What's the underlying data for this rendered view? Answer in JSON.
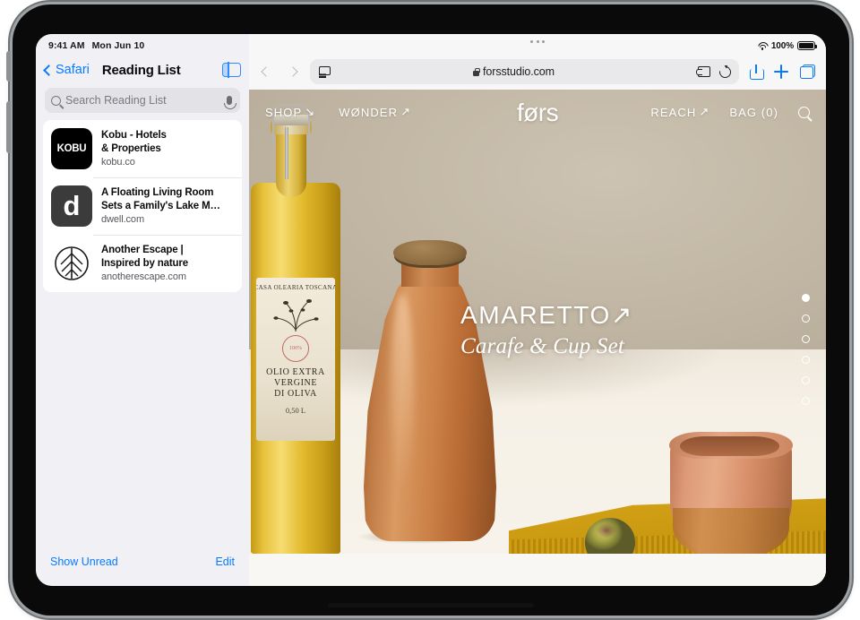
{
  "status_bar": {
    "time": "9:41 AM",
    "date": "Mon Jun 10",
    "battery_percent": "100%",
    "wifi_icon": "wifi-icon",
    "battery_icon": "battery-icon"
  },
  "sidebar": {
    "back_label": "Safari",
    "back_icon": "chevron-left-icon",
    "title": "Reading List",
    "toggle_icon": "sidebar-toggle-icon",
    "search": {
      "placeholder": "Search Reading List",
      "value": "",
      "search_icon": "search-icon",
      "mic_icon": "microphone-icon"
    },
    "items": [
      {
        "thumb_text": "KOBU",
        "thumb_style": "kobu",
        "title_line1": "Kobu - Hotels",
        "title_line2": "& Properties",
        "host": "kobu.co"
      },
      {
        "thumb_text": "d",
        "thumb_style": "dwell",
        "title_line1": "A Floating Living Room",
        "title_line2": "Sets a Family's Lake M…",
        "host": "dwell.com"
      },
      {
        "thumb_text": "",
        "thumb_style": "leaf",
        "thumb_icon": "leaf-circle-icon",
        "title_line1": "Another Escape |",
        "title_line2": "Inspired by nature",
        "host": "anotherescape.com"
      }
    ],
    "footer": {
      "show_unread_label": "Show Unread",
      "edit_label": "Edit"
    }
  },
  "browser": {
    "back_icon": "chevron-left-icon",
    "forward_icon": "chevron-right-icon",
    "reader_icon": "reader-view-icon",
    "lock_icon": "lock-icon",
    "url": "forsstudio.com",
    "extension_icon": "extension-puzzle-icon",
    "reload_icon": "reload-icon",
    "share_icon": "share-icon",
    "new_tab_icon": "plus-icon",
    "tabs_icon": "tab-overview-icon",
    "window_dots_icon": "window-controls-icon"
  },
  "webpage": {
    "nav_left": [
      {
        "label": "SHOP",
        "arrow": "↘",
        "arrow_icon": "arrow-down-right-icon"
      },
      {
        "label": "WØNDER",
        "arrow": "↗",
        "arrow_icon": "arrow-up-right-icon"
      }
    ],
    "brand": "førs",
    "nav_right": [
      {
        "label": "REACH",
        "arrow": "↗",
        "arrow_icon": "arrow-up-right-icon"
      },
      {
        "label": "BAG (0)",
        "arrow": "",
        "arrow_icon": ""
      }
    ],
    "search_icon": "search-icon",
    "hero": {
      "title": "AMARETTO",
      "title_arrow": "↗",
      "subtitle": "Carafe & Cup Set"
    },
    "pagination": {
      "total": 6,
      "active_index": 0
    },
    "product_photo": {
      "bottle_label": {
        "brand": "CASA OLEARIA TOSCANA",
        "stamp": "100%",
        "line1": "OLIO EXTRA",
        "line2": "VERGINE",
        "line3": "DI OLIVA",
        "volume": "0,50 L"
      }
    }
  },
  "colors": {
    "accent_blue": "#067bff",
    "sidebar_bg": "#f1f0f5",
    "hero_bg": "#beb3a0",
    "terracotta": "#c8834f",
    "cloth_yellow": "#c8980f"
  }
}
